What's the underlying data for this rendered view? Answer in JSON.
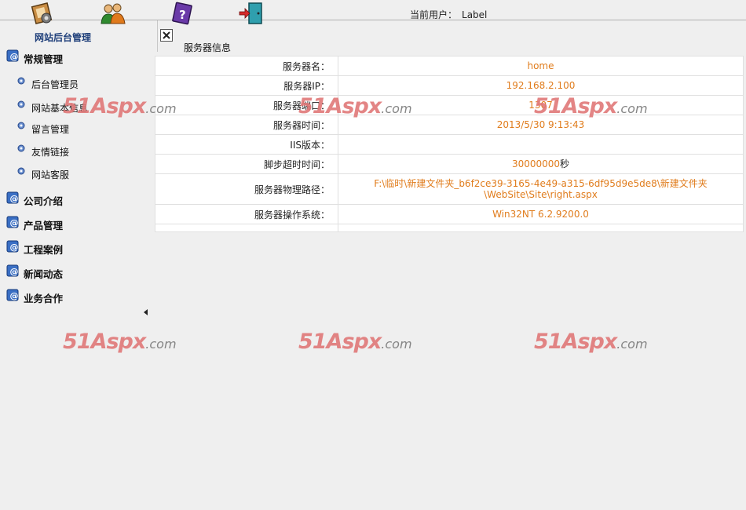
{
  "toolbar": {
    "tools": [
      {
        "name": "settings-book-icon"
      },
      {
        "name": "users-icon"
      },
      {
        "name": "help-book-icon"
      },
      {
        "name": "exit-door-icon"
      }
    ],
    "current_user_label": "当前用户：",
    "current_user_value": "Label"
  },
  "sidebar": {
    "title": "网站后台管理",
    "groups": [
      {
        "label": "常规管理",
        "items": [
          "后台管理员",
          "网站基本信息",
          "留言管理",
          "友情链接",
          "网站客服"
        ]
      },
      {
        "label": "公司介绍"
      },
      {
        "label": "产品管理"
      },
      {
        "label": "工程案例"
      },
      {
        "label": "新闻动态"
      },
      {
        "label": "业务合作"
      }
    ]
  },
  "content": {
    "tab_label": "服务器信息",
    "rows": [
      {
        "key": "服务器名：",
        "value": "home"
      },
      {
        "key": "服务器IP：",
        "value": "192.168.2.100"
      },
      {
        "key": "服务器端口：",
        "value": "1307"
      },
      {
        "key": "服务器时间：",
        "value": "2013/5/30 9:13:43"
      },
      {
        "key": "IIS版本：",
        "value": ""
      },
      {
        "key": "脚步超时时间：",
        "value": "30000000",
        "unit": "秒"
      },
      {
        "key": "服务器物理路径：",
        "value_line1": "F:\\临时\\新建文件夹_b6f2ce39-3165-4e49-a315-6df95d9e5de8\\新建文件夹",
        "value_line2": "\\WebSite\\Site\\right.aspx"
      },
      {
        "key": "服务器操作系统：",
        "value": "Win32NT 6.2.9200.0"
      }
    ]
  },
  "watermark": {
    "brand": "51Aspx",
    "suffix": ".com"
  },
  "colors": {
    "value_text": "#e07c1c",
    "title_blue": "#1f3f7a",
    "watermark_red": "#e07878"
  }
}
